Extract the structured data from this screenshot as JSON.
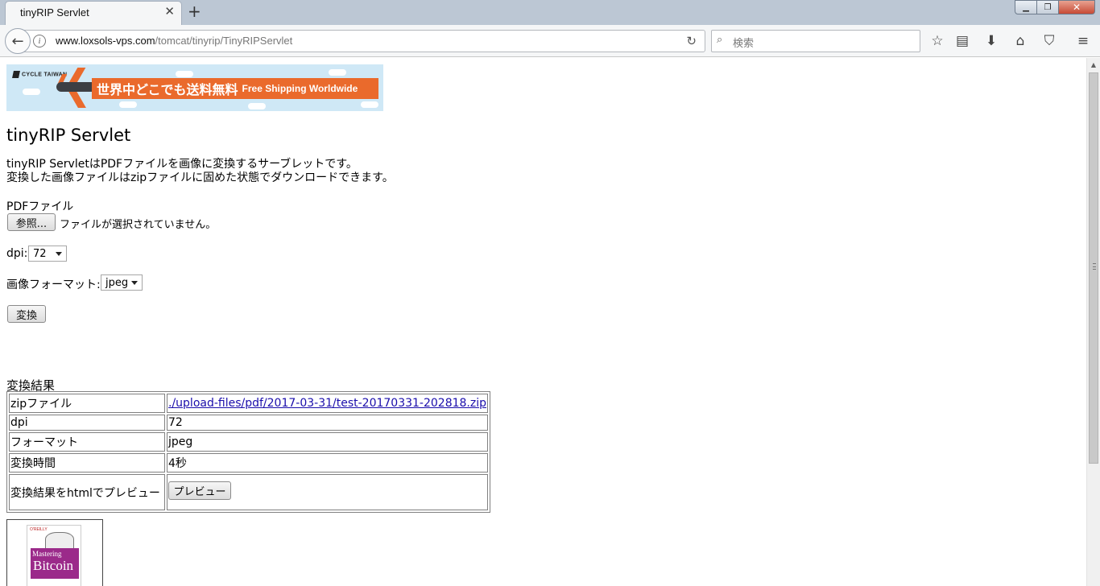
{
  "browser": {
    "tab_title": "tinyRIP Servlet",
    "url_host": "www.loxsols-vps.com",
    "url_path": "/tomcat/tinyrip/TinyRIPServlet",
    "search_placeholder": "検索"
  },
  "banner": {
    "brand": "CYCLE TAIWAN",
    "text_jp": "世界中どこでも送料無料",
    "text_en": "Free Shipping Worldwide"
  },
  "page": {
    "title": "tinyRIP Servlet",
    "intro_line1": "tinyRIP ServletはPDFファイルを画像に変換するサーブレットです。",
    "intro_line2": "変換した画像ファイルはzipファイルに固めた状態でダウンロードできます。"
  },
  "form": {
    "pdf_label": "PDFファイル",
    "browse_button": "参照...",
    "file_status": "ファイルが選択されていません。",
    "dpi_label": "dpi:",
    "dpi_value": "72",
    "format_label": "画像フォーマット:",
    "format_value": "jpeg",
    "convert_button": "変換"
  },
  "result": {
    "heading": "変換結果",
    "rows": [
      {
        "key": "zipファイル",
        "value": "./upload-files/pdf/2017-03-31/test-20170331-202818.zip"
      },
      {
        "key": "dpi",
        "value": "72"
      },
      {
        "key": "フォーマット",
        "value": "jpeg"
      },
      {
        "key": "変換時間",
        "value": "4秒"
      },
      {
        "key": "変換結果をhtmlでプレビュー",
        "value": "プレビュー"
      }
    ]
  },
  "thumbnail": {
    "publisher": "O'REILLY",
    "title_line1": "Mastering",
    "title_line2": "Bitcoin"
  }
}
